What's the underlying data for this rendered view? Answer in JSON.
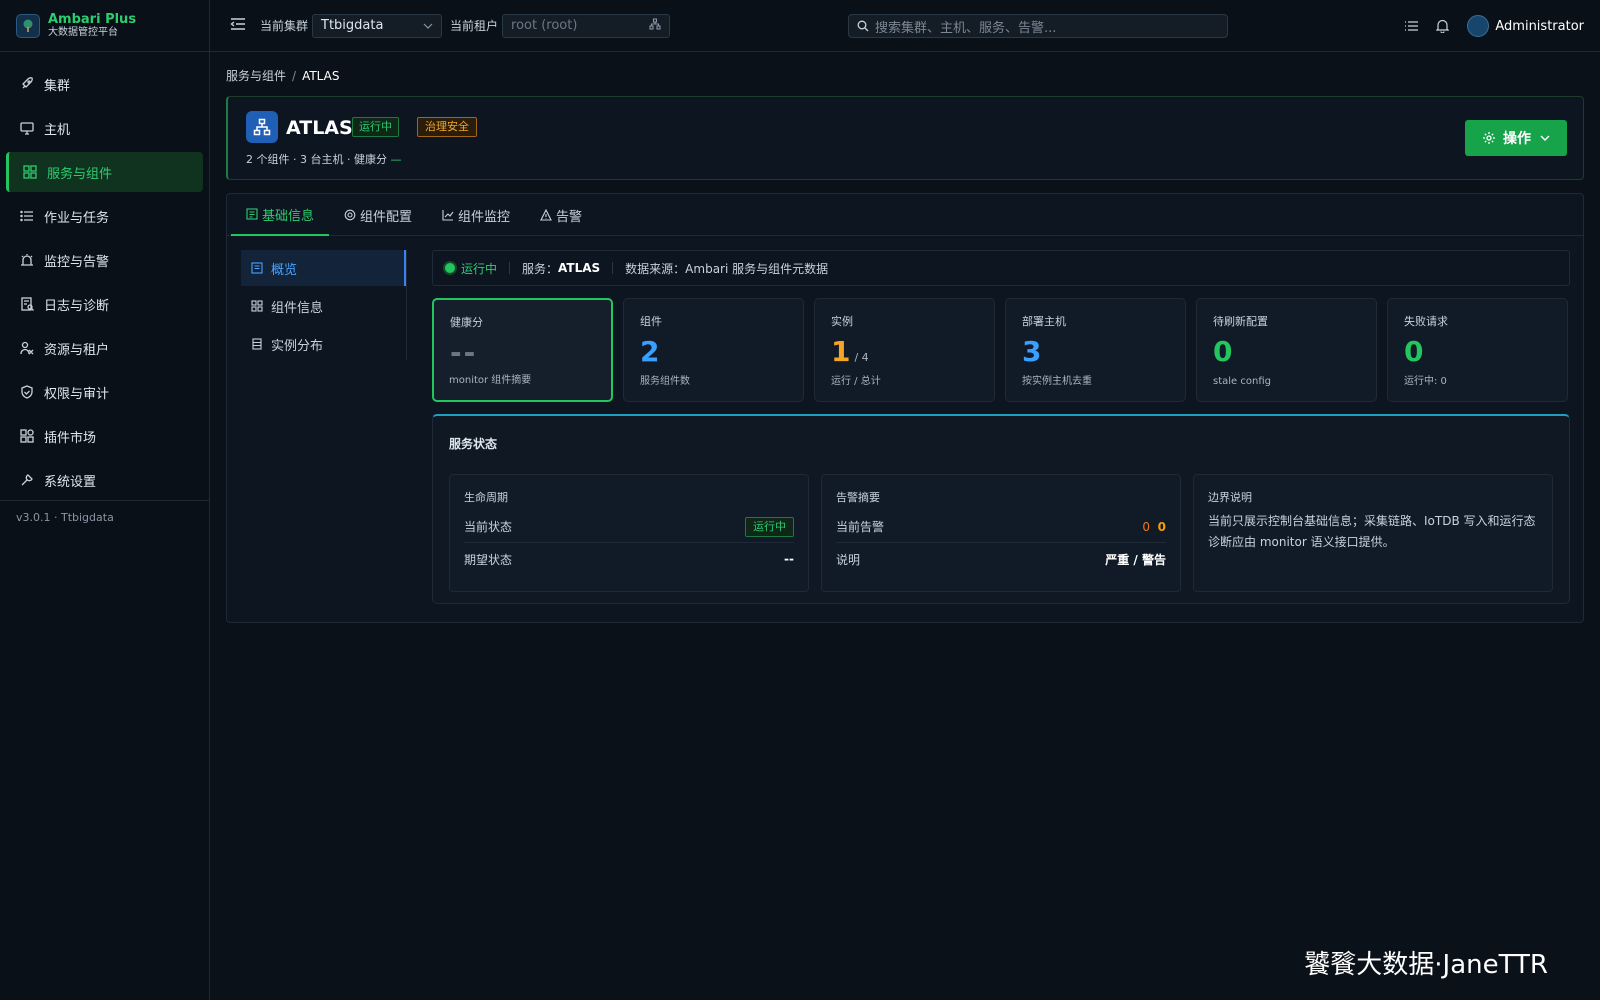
{
  "brand": {
    "title": "Ambari Plus",
    "subtitle": "大数据管控平台"
  },
  "nav": [
    {
      "label": "集群",
      "icon": "rocket-icon"
    },
    {
      "label": "主机",
      "icon": "monitor-icon"
    },
    {
      "label": "服务与组件",
      "icon": "grid-icon",
      "active": true
    },
    {
      "label": "作业与任务",
      "icon": "list-icon"
    },
    {
      "label": "监控与告警",
      "icon": "alarm-icon"
    },
    {
      "label": "日志与诊断",
      "icon": "log-icon"
    },
    {
      "label": "资源与租户",
      "icon": "users-icon"
    },
    {
      "label": "权限与审计",
      "icon": "shield-icon"
    },
    {
      "label": "插件市场",
      "icon": "plugin-icon"
    },
    {
      "label": "系统设置",
      "icon": "wrench-icon"
    }
  ],
  "version": "v3.0.1 · Ttbigdata",
  "topbar": {
    "cluster_label": "当前集群",
    "cluster_value": "Ttbigdata",
    "tenant_label": "当前租户",
    "tenant_placeholder": "root (root)",
    "search_placeholder": "搜索集群、主机、服务、告警...",
    "user": "Administrator"
  },
  "breadcrumb": {
    "parent": "服务与组件",
    "sep": "/",
    "current": "ATLAS"
  },
  "service": {
    "name": "ATLAS",
    "status": "运行中",
    "tag": "治理安全",
    "summary": "2 个组件 · 3 台主机 · 健康分",
    "health_dash": "—",
    "action": "操作"
  },
  "tabs": [
    {
      "label": "基础信息",
      "icon": "info-icon",
      "active": true
    },
    {
      "label": "组件配置",
      "icon": "gear-icon"
    },
    {
      "label": "组件监控",
      "icon": "chart-icon"
    },
    {
      "label": "告警",
      "icon": "warning-icon"
    }
  ],
  "subnav": [
    {
      "label": "概览",
      "icon": "doc-icon",
      "active": true
    },
    {
      "label": "组件信息",
      "icon": "grid-icon"
    },
    {
      "label": "实例分布",
      "icon": "table-icon"
    }
  ],
  "statusbar": {
    "state": "运行中",
    "svc_label": "服务：",
    "svc_value": "ATLAS",
    "src_label": "数据来源：",
    "src_value": "Ambari 服务与组件元数据"
  },
  "cards": [
    {
      "title": "健康分",
      "value": "--",
      "sub": "monitor 组件摘要",
      "color": "#6b7785",
      "highlight": true
    },
    {
      "title": "组件",
      "value": "2",
      "sub": "服务组件数",
      "color": "#3aa0ff"
    },
    {
      "title": "实例",
      "value": "1",
      "extra": "/ 4",
      "sub": "运行 / 总计",
      "color": "#f5a524"
    },
    {
      "title": "部署主机",
      "value": "3",
      "sub": "按实例主机去重",
      "color": "#3aa0ff"
    },
    {
      "title": "待刷新配置",
      "value": "0",
      "sub": "stale config",
      "color": "#22c55e"
    },
    {
      "title": "失败请求",
      "value": "0",
      "sub": "运行中: 0",
      "color": "#22c55e"
    }
  ],
  "service_status": {
    "title": "服务状态",
    "lifecycle": {
      "title": "生命周期",
      "current_label": "当前状态",
      "current_value": "运行中",
      "desired_label": "期望状态",
      "desired_value": "--"
    },
    "alerts": {
      "title": "告警摘要",
      "current_label": "当前告警",
      "critical": "0",
      "warning": "0",
      "note_label": "说明",
      "note_value": "严重 / 警告"
    },
    "boundary": {
      "title": "边界说明",
      "text": "当前只展示控制台基础信息；采集链路、IoTDB 写入和运行态诊断应由 monitor 语义接口提供。"
    }
  },
  "watermark": "饕餮大数据·JaneTTR"
}
